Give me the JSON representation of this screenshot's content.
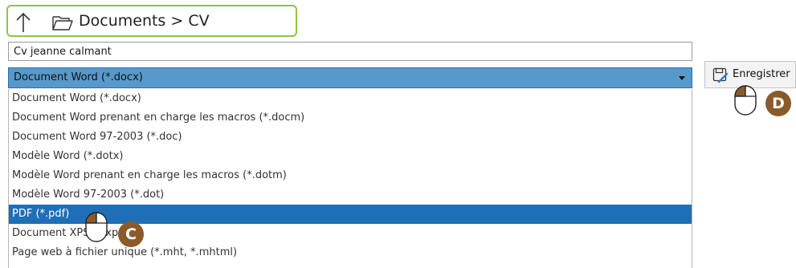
{
  "breadcrumb": {
    "path": "Documents > CV",
    "up_icon": "up-arrow-icon",
    "folder_icon": "folder-open-icon"
  },
  "filename": {
    "value": "Cv jeanne calmant"
  },
  "file_type": {
    "selected": "Document Word (*.docx)",
    "options": [
      "Document Word (*.docx)",
      "Document Word prenant en charge les macros (*.docm)",
      "Document Word 97-2003 (*.doc)",
      "Modèle Word (*.dotx)",
      "Modèle Word prenant en charge les macros (*.dotm)",
      "Modèle Word 97-2003 (*.dot)",
      "PDF (*.pdf)",
      "Document XPS (*.xps)",
      "Page web à fichier unique (*.mht, *.mhtml)"
    ],
    "highlighted_index": 6
  },
  "save_button": {
    "label": "Enregistrer",
    "icon": "save-icon"
  },
  "annotations": {
    "step_c": "C",
    "step_d": "D",
    "badge_color": "#8b5a2b",
    "outline_color": "#8cc63f"
  },
  "colors": {
    "select_bg": "#5799cc",
    "highlight_bg": "#1e6fb5"
  }
}
